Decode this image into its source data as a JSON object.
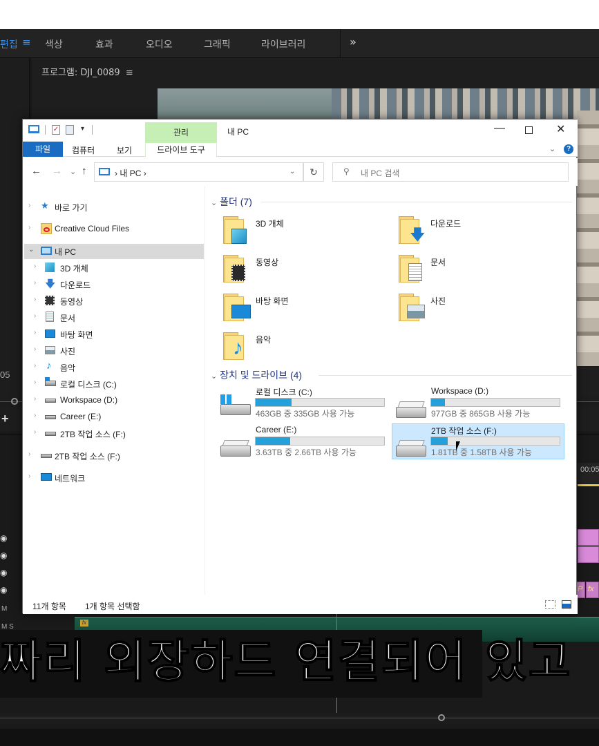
{
  "premiere": {
    "workspaces": [
      "편집",
      "색상",
      "효과",
      "오디오",
      "그래픽",
      "라이브러리"
    ],
    "more": "»",
    "menu_icon": "≡",
    "program_title": "프로그램: DJI_0089",
    "program_menu": "≡",
    "timecode_left": "05",
    "ruler_time": "00:05",
    "track_labels": {
      "m1": "M",
      "s1": "S",
      "m2": "M  S"
    },
    "fx_label": "fx",
    "p_label": "P",
    "fx2_label": "fx"
  },
  "subtitle": "짜리 외장하드 연결되어 있고",
  "explorer": {
    "title": "내 PC",
    "manage_tab": "관리",
    "ribbon_tabs": {
      "file": "파일",
      "computer": "컴퓨터",
      "view": "보기",
      "drive_tools": "드라이브 도구"
    },
    "window_controls": {
      "min": "—",
      "close": "✕"
    },
    "help": "?",
    "address": {
      "path": "›  내 PC  ›",
      "dropdown": "⌄",
      "refresh": "↻"
    },
    "search_placeholder": "내 PC 검색",
    "nav": {
      "back": "←",
      "forward": "→",
      "dropdown": "⌄",
      "up": "↑"
    },
    "nav_items": [
      {
        "label": "바로 가기",
        "icon": "star-icon"
      },
      {
        "label": "Creative Cloud Files",
        "icon": "creative-cloud-folder-icon"
      },
      {
        "label": "내 PC",
        "icon": "computer-icon"
      },
      {
        "label": "3D 개체",
        "icon": "3d-objects-icon"
      },
      {
        "label": "다운로드",
        "icon": "download-icon"
      },
      {
        "label": "동영상",
        "icon": "video-icon"
      },
      {
        "label": "문서",
        "icon": "document-icon"
      },
      {
        "label": "바탕 화면",
        "icon": "desktop-icon"
      },
      {
        "label": "사진",
        "icon": "picture-icon"
      },
      {
        "label": "음악",
        "icon": "music-icon"
      },
      {
        "label": "로컬 디스크 (C:)",
        "icon": "drive-icon"
      },
      {
        "label": "Workspace (D:)",
        "icon": "drive-icon"
      },
      {
        "label": "Career (E:)",
        "icon": "drive-icon"
      },
      {
        "label": "2TB 작업 소스 (F:)",
        "icon": "drive-icon"
      },
      {
        "label": "2TB 작업 소스 (F:)",
        "icon": "drive-icon"
      },
      {
        "label": "네트워크",
        "icon": "network-icon"
      }
    ],
    "folders_header": "폴더 (7)",
    "folders": [
      {
        "label": "3D 개체",
        "icon": "3d-objects-folder-icon"
      },
      {
        "label": "다운로드",
        "icon": "download-folder-icon"
      },
      {
        "label": "동영상",
        "icon": "video-folder-icon"
      },
      {
        "label": "문서",
        "icon": "document-folder-icon"
      },
      {
        "label": "바탕 화면",
        "icon": "desktop-folder-icon"
      },
      {
        "label": "사진",
        "icon": "picture-folder-icon"
      },
      {
        "label": "음악",
        "icon": "music-folder-icon"
      }
    ],
    "drives_header": "장치 및 드라이브 (4)",
    "drives": [
      {
        "label": "로컬 디스크 (C:)",
        "space": "463GB 중 335GB 사용 가능",
        "used_fraction": 0.28
      },
      {
        "label": "Workspace (D:)",
        "space": "977GB 중 865GB 사용 가능",
        "used_fraction": 0.11
      },
      {
        "label": "Career (E:)",
        "space": "3.63TB 중 2.66TB 사용 가능",
        "used_fraction": 0.27
      },
      {
        "label": "2TB 작업 소스 (F:)",
        "space": "1.81TB 중 1.58TB 사용 가능",
        "used_fraction": 0.13
      }
    ],
    "status": {
      "count": "11개 항목",
      "selected": "1개 항목 선택함"
    },
    "chevron": "›",
    "expanded_chevron": "⌄"
  },
  "colors": {
    "accent": "#1a6bc2",
    "premiere_accent": "#3a8ee6",
    "manage_green": "#c6efb6",
    "drive_bar": "#26a0da"
  }
}
